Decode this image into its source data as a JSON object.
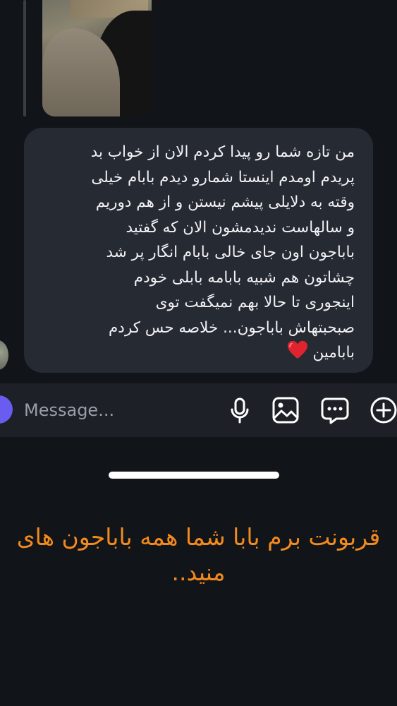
{
  "message": {
    "text": "من تازه شما رو پیدا کردم الان از خواب بد\nپریدم اومدم اینستا شمارو دیدم بابام خیلی\nوقته به دلایلی پیشم نیستن و از هم دوریم\nو سالهاست ندیدمشون الان که گفتید\nباباجون اون جای خالی بابام انگار پر شد\nچشاتون هم شبیه بابامه بابلی خودم\nاینجوری تا حالا بهم نمیگفت توی\nصبحبتهاش باباجون... خلاصه حس کردم\nبابامین",
    "emoji": "red-heart"
  },
  "composer": {
    "placeholder": "Message...",
    "icons": [
      "microphone-icon",
      "image-icon",
      "sticker-icon",
      "plus-icon"
    ]
  },
  "caption": {
    "text": "قربونت برم بابا شما همه باباجون های\nمنید.."
  },
  "colors": {
    "background": "#111419",
    "bubble": "#262a33",
    "composer": "#1d2027",
    "caption": "#f28a1e",
    "accent": "#6a5cf0"
  }
}
